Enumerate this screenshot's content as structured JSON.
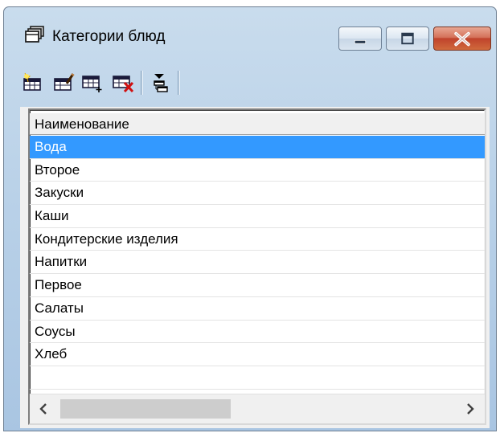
{
  "window": {
    "title": "Категории блюд"
  },
  "title_buttons": [
    {
      "name": "minimize",
      "icon": "minimize-icon"
    },
    {
      "name": "maximize",
      "icon": "maximize-icon"
    },
    {
      "name": "close",
      "icon": "close-icon"
    }
  ],
  "toolbar": {
    "buttons": [
      {
        "icon": "new-record-icon"
      },
      {
        "icon": "edit-record-icon"
      },
      {
        "icon": "add-record-icon"
      },
      {
        "icon": "delete-record-icon"
      },
      {
        "icon": "move-down-icon"
      }
    ]
  },
  "grid": {
    "column_header": "Наименование",
    "rows": [
      "Вода",
      "Второе",
      "Закуски",
      "Каши",
      "Кондитерские изделия",
      "Напитки",
      "Первое",
      "Салаты",
      "Соусы",
      "Хлеб"
    ],
    "selected_index": 0
  },
  "colors": {
    "selection": "#3399ff",
    "close_button": "#c0432c"
  }
}
